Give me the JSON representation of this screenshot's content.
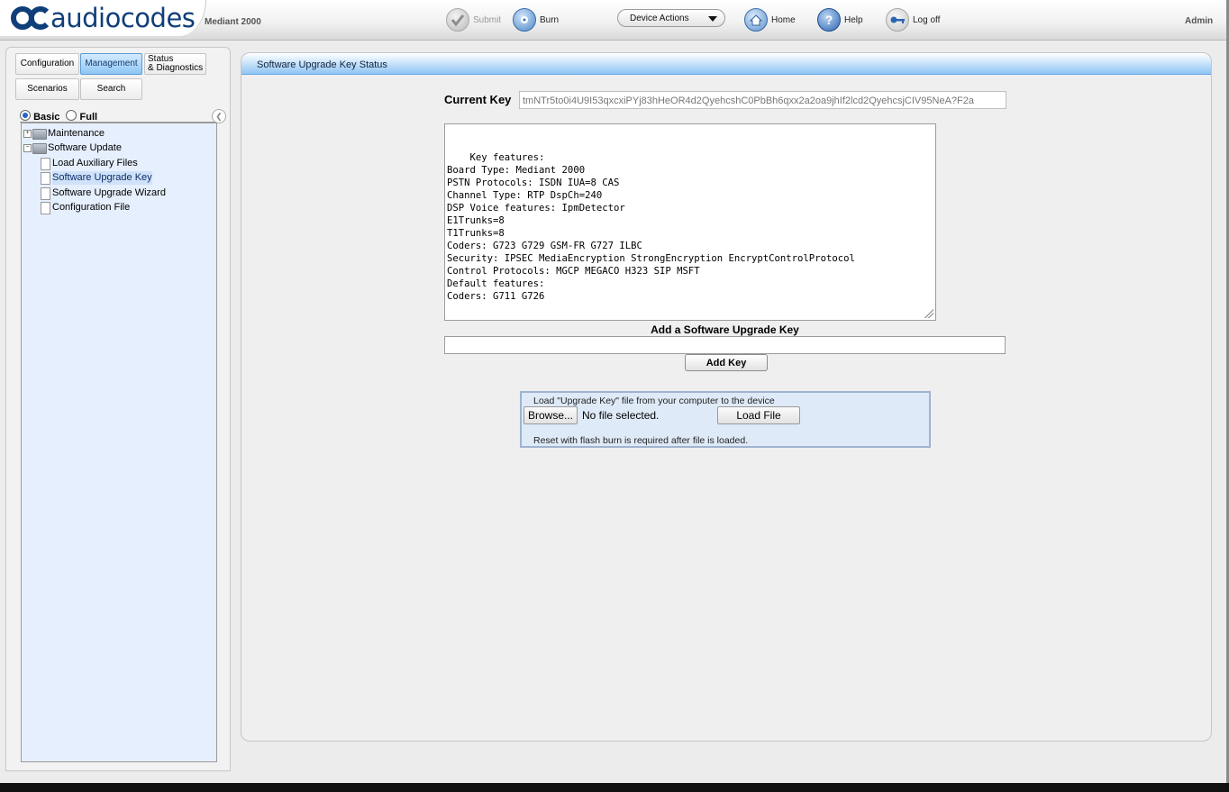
{
  "header": {
    "logo_text": "audiocodes",
    "product": "Mediant 2000",
    "submit_label": "Submit",
    "burn_label": "Burn",
    "device_actions_label": "Device Actions",
    "home_label": "Home",
    "help_label": "Help",
    "logoff_label": "Log off",
    "user": "Admin"
  },
  "nav": {
    "tabs": [
      {
        "label": "Configuration"
      },
      {
        "label": "Management",
        "active": true
      },
      {
        "label": "Status\n& Diagnostics"
      },
      {
        "label": "Scenarios"
      },
      {
        "label": "Search"
      }
    ],
    "mode_basic": "Basic",
    "mode_full": "Full",
    "tree": [
      {
        "label": "Maintenance",
        "type": "folder",
        "expanded": false
      },
      {
        "label": "Software Update",
        "type": "folder",
        "expanded": true
      },
      {
        "label": "Load Auxiliary Files",
        "type": "file"
      },
      {
        "label": "Software Upgrade Key",
        "type": "file",
        "selected": true
      },
      {
        "label": "Software Upgrade Wizard",
        "type": "file"
      },
      {
        "label": "Configuration File",
        "type": "file"
      }
    ]
  },
  "main": {
    "panel_title": "Software Upgrade Key Status",
    "current_key_label": "Current Key",
    "current_key_value": "tmNTr5to0i4U9I53qxcxiPYj83hHeOR4d2QyehcshC0PbBh6qxx2a2oa9jhIf2lcd2QyehcsjCIV95NeA?F2a",
    "features_text": "Key features:\nBoard Type: Mediant 2000\nPSTN Protocols: ISDN IUA=8 CAS\nChannel Type: RTP DspCh=240\nDSP Voice features: IpmDetector\nE1Trunks=8\nT1Trunks=8\nCoders: G723 G729 GSM-FR G727 ILBC\nSecurity: IPSEC MediaEncryption StrongEncryption EncryptControlProtocol\nControl Protocols: MGCP MEGACO H323 SIP MSFT\nDefault features:\nCoders: G711 G726",
    "add_key_title": "Add a Software Upgrade Key",
    "add_key_value": "",
    "add_key_button": "Add Key",
    "upload_title": "Load \"Upgrade Key\" file from your computer to the device",
    "browse_button": "Browse...",
    "no_file_text": "No file selected.",
    "load_file_button": "Load File",
    "upload_note": "Reset with flash burn is required after file is loaded."
  },
  "colors": {
    "brand": "#0f3e7a",
    "active_tab": "#8ec6f5",
    "tree_bg": "#e6effd",
    "panel_header": "#8fc4f4"
  }
}
